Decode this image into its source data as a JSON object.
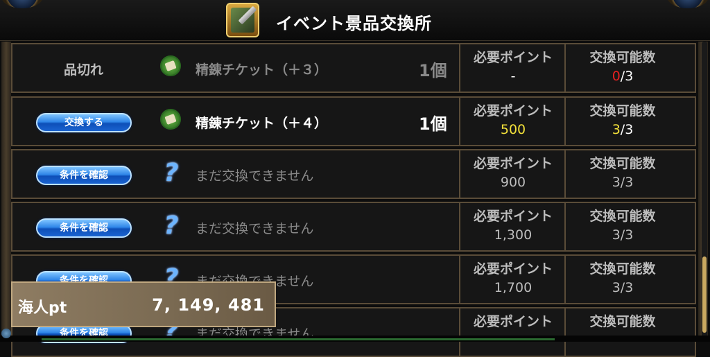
{
  "header": {
    "title": "イベント景品交換所",
    "icon": "sword-shop-icon"
  },
  "labels": {
    "need_points": "必要ポイント",
    "exchangeable": "交換可能数"
  },
  "rows": [
    {
      "action": "品切れ",
      "action_type": "soldout",
      "item_icon": "ticket-icon",
      "item": "精錬チケット（＋３）",
      "qty": "1個",
      "points": "-",
      "count_cur": "0",
      "count_max": "/3"
    },
    {
      "action": "交換する",
      "action_type": "button",
      "item_icon": "ticket-icon",
      "item": "精錬チケット（＋４）",
      "qty": "1個",
      "points": "500",
      "count_cur": "3",
      "count_max": "/3"
    },
    {
      "action": "条件を確認",
      "action_type": "button",
      "item_icon": "question-icon",
      "item": "まだ交換できません",
      "qty": "",
      "points": "900",
      "count_cur": "3",
      "count_max": "/3"
    },
    {
      "action": "条件を確認",
      "action_type": "button",
      "item_icon": "question-icon",
      "item": "まだ交換できません",
      "qty": "",
      "points": "1,300",
      "count_cur": "3",
      "count_max": "/3"
    },
    {
      "action": "条件を確認",
      "action_type": "button",
      "item_icon": "question-icon",
      "item": "まだ交換できません",
      "qty": "",
      "points": "1,700",
      "count_cur": "3",
      "count_max": "/3"
    },
    {
      "action": "条件を確認",
      "action_type": "button",
      "item_icon": "question-icon",
      "item": "まだ交換できません",
      "qty": "",
      "points": "",
      "count_cur": "",
      "count_max": ""
    }
  ],
  "points_panel": {
    "label": "海人pt",
    "value": "7, 149, 481"
  },
  "colors": {
    "highlight_yellow": "#f2e03a",
    "soldout_red": "#e82020",
    "button_blue": "#2f86e8"
  }
}
